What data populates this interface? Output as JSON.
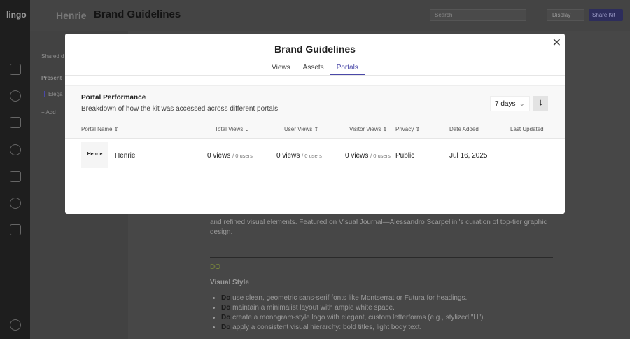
{
  "app": {
    "logo": "lingo",
    "breadcrumb": [
      "Henrie",
      "Brand Guidelines"
    ],
    "search_placeholder": "Search",
    "display_label": "Display",
    "share_label": "Share Kit"
  },
  "sidebar": {
    "shared": "Shared d",
    "presentation": "Present",
    "item": "Elega",
    "add": "+ Add"
  },
  "content": {
    "paragraph": "and refined visual elements. Featured on Visual Journal—Alessandro Scarpellini's curation of top-tier graphic design.",
    "do_label": "DO",
    "heading": "Visual Style",
    "bullets": [
      {
        "b": "Do",
        "t": " use clean, geometric sans-serif fonts like Montserrat or Futura for headings."
      },
      {
        "b": "Do",
        "t": " maintain a minimalist layout with ample white space."
      },
      {
        "b": "Do",
        "t": " create a monogram-style logo with elegant, custom letterforms (e.g., stylized \"H\")."
      },
      {
        "b": "Do",
        "t": " apply a consistent visual hierarchy: bold titles, light body text."
      }
    ]
  },
  "modal": {
    "title": "Brand Guidelines",
    "tabs": [
      "Views",
      "Assets",
      "Portals"
    ],
    "active_tab": "Portals",
    "panel_title": "Portal Performance",
    "panel_subtitle": "Breakdown of how the kit was accessed across different portals.",
    "range": "7 days",
    "columns": [
      "Portal Name",
      "Total Views",
      "User Views",
      "Visitor Views",
      "Privacy",
      "Date Added",
      "Last Updated"
    ],
    "rows": [
      {
        "thumb": "Henrie",
        "name": "Henrie",
        "total": "0 views",
        "total_users": "/ 0 users",
        "user": "0 views",
        "user_users": "/ 0 users",
        "visitor": "0 views",
        "visitor_users": "/ 0 users",
        "privacy": "Public",
        "date_added": "Jul 16, 2025",
        "last_updated": ""
      }
    ]
  },
  "colors": {
    "accent": "#4a48a8"
  }
}
